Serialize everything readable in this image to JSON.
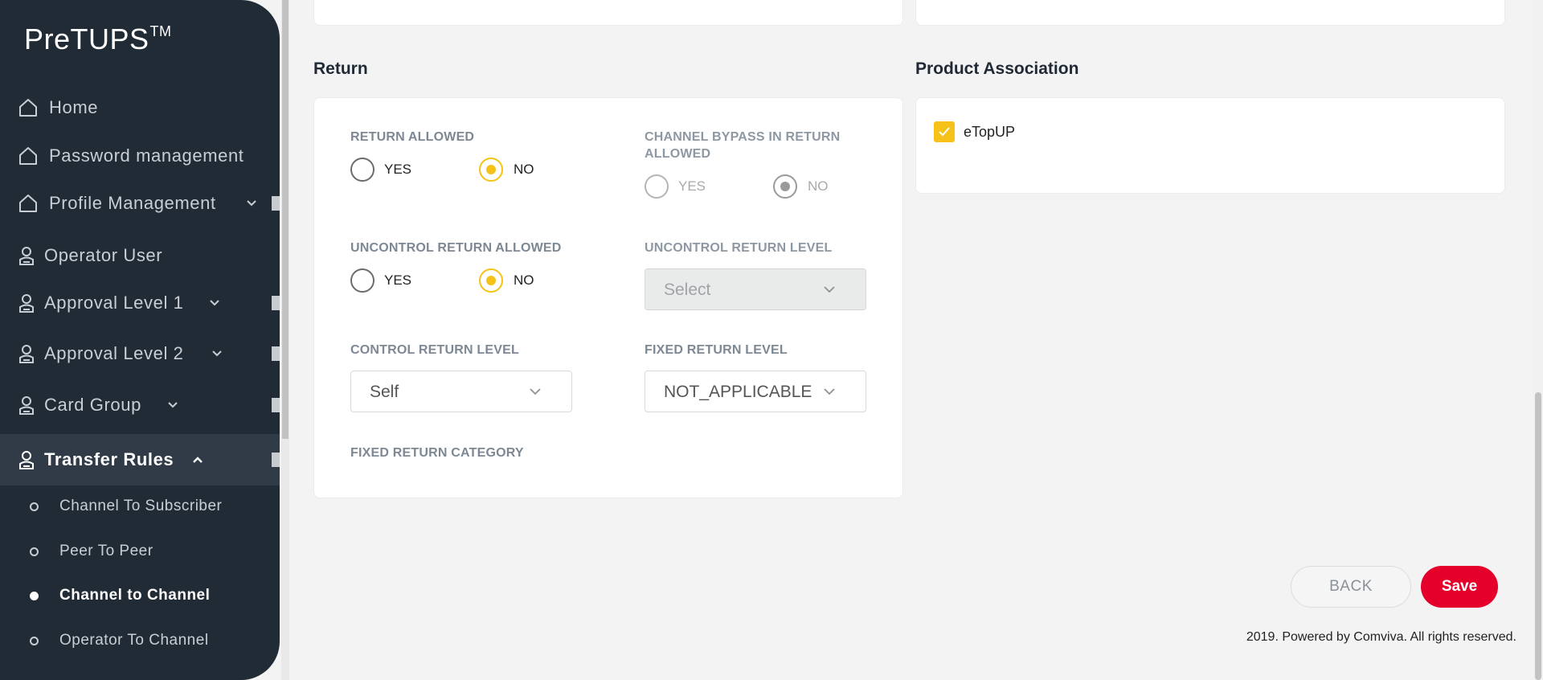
{
  "app": {
    "logo": "PreTUPS",
    "logo_tm": "TM"
  },
  "sidebar": {
    "items": [
      {
        "label": "Home",
        "icon": "home-icon"
      },
      {
        "label": "Password management",
        "icon": "home-icon"
      },
      {
        "label": "Profile Management",
        "icon": "home-icon",
        "expandable": true
      },
      {
        "label": "Operator User",
        "icon": "user-icon"
      },
      {
        "label": "Approval Level 1",
        "icon": "user-icon",
        "expandable": true
      },
      {
        "label": "Approval Level 2",
        "icon": "user-icon",
        "expandable": true
      },
      {
        "label": "Card Group",
        "icon": "user-icon",
        "expandable": true
      },
      {
        "label": "Transfer Rules",
        "icon": "user-icon",
        "expanded": true,
        "active": true
      }
    ],
    "sub_items": [
      {
        "label": "Channel To Subscriber"
      },
      {
        "label": "Peer To Peer"
      },
      {
        "label": "Channel to Channel",
        "active": true
      },
      {
        "label": "Operator To Channel"
      }
    ]
  },
  "return_section": {
    "title": "Return",
    "return_allowed": {
      "label": "RETURN ALLOWED",
      "yes": "YES",
      "no": "NO",
      "selected": "NO"
    },
    "channel_bypass": {
      "label": "CHANNEL BYPASS IN RETURN ALLOWED",
      "yes": "YES",
      "no": "NO",
      "selected": "NO",
      "disabled": true
    },
    "uncontrol_return_allowed": {
      "label": "UNCONTROL RETURN ALLOWED",
      "yes": "YES",
      "no": "NO",
      "selected": "NO"
    },
    "uncontrol_return_level": {
      "label": "UNCONTROL RETURN LEVEL",
      "value": "Select",
      "disabled": true
    },
    "control_return_level": {
      "label": "CONTROL RETURN LEVEL",
      "value": "Self"
    },
    "fixed_return_level": {
      "label": "FIXED RETURN LEVEL",
      "value": "NOT_APPLICABLE"
    },
    "fixed_return_category": {
      "label": "FIXED RETURN CATEGORY"
    }
  },
  "product_association": {
    "title": "Product Association",
    "items": [
      {
        "label": "eTopUP",
        "checked": true
      }
    ]
  },
  "actions": {
    "back": "BACK",
    "save": "Save"
  },
  "footer": {
    "text": "2019. Powered by Comviva. All rights reserved."
  },
  "colors": {
    "sidebar_bg": "#212b36",
    "accent_yellow": "#f6c21a",
    "save_red": "#e4002b"
  }
}
